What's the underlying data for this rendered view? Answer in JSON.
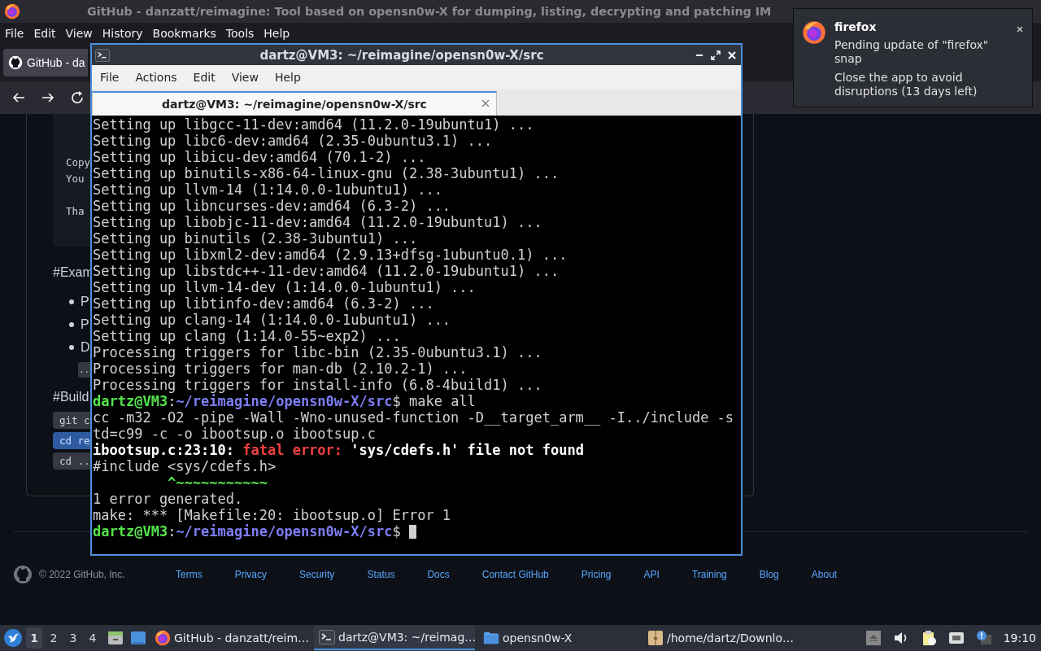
{
  "browser": {
    "title": "GitHub - danzatt/reimagine: Tool based on opensn0w-X for dumping, listing, decrypting and patching IM",
    "menu": [
      "File",
      "Edit",
      "View",
      "History",
      "Bookmarks",
      "Tools",
      "Help"
    ],
    "tabs": [
      {
        "label": "GitHub - da",
        "selected": true
      }
    ],
    "page": {
      "code_lines": [
        "Copy",
        "You",
        "Tha"
      ],
      "examples_heading": "#Exam",
      "bullets": [
        "P",
        "P",
        "D"
      ],
      "inline_code": "..",
      "build_heading": "#Build",
      "build_code": [
        {
          "text": "git c",
          "selected": false
        },
        {
          "text": "cd re",
          "selected": true
        },
        {
          "text": "cd ..",
          "selected": false
        }
      ],
      "footer": {
        "copyright": "© 2022 GitHub, Inc.",
        "links": [
          "Terms",
          "Privacy",
          "Security",
          "Status",
          "Docs",
          "Contact GitHub",
          "Pricing",
          "API",
          "Training",
          "Blog",
          "About"
        ]
      }
    }
  },
  "terminal": {
    "title": "dartz@VM3: ~/reimagine/opensn0w-X/src",
    "menu": [
      "File",
      "Actions",
      "Edit",
      "View",
      "Help"
    ],
    "tabs": [
      {
        "label": "dartz@VM3: ~/reimagine/opensn0w-X/src",
        "selected": true
      }
    ],
    "lines": [
      {
        "segments": [
          {
            "text": "Setting up libgcc-11-dev:amd64 (11.2.0-19ubuntu1) ...",
            "kind": "plain"
          }
        ]
      },
      {
        "segments": [
          {
            "text": "Setting up libc6-dev:amd64 (2.35-0ubuntu3.1) ...",
            "kind": "plain"
          }
        ]
      },
      {
        "segments": [
          {
            "text": "Setting up libicu-dev:amd64 (70.1-2) ...",
            "kind": "plain"
          }
        ]
      },
      {
        "segments": [
          {
            "text": "Setting up binutils-x86-64-linux-gnu (2.38-3ubuntu1) ...",
            "kind": "plain"
          }
        ]
      },
      {
        "segments": [
          {
            "text": "Setting up llvm-14 (1:14.0.0-1ubuntu1) ...",
            "kind": "plain"
          }
        ]
      },
      {
        "segments": [
          {
            "text": "Setting up libncurses-dev:amd64 (6.3-2) ...",
            "kind": "plain"
          }
        ]
      },
      {
        "segments": [
          {
            "text": "Setting up libobjc-11-dev:amd64 (11.2.0-19ubuntu1) ...",
            "kind": "plain"
          }
        ]
      },
      {
        "segments": [
          {
            "text": "Setting up binutils (2.38-3ubuntu1) ...",
            "kind": "plain"
          }
        ]
      },
      {
        "segments": [
          {
            "text": "Setting up libxml2-dev:amd64 (2.9.13+dfsg-1ubuntu0.1) ...",
            "kind": "plain"
          }
        ]
      },
      {
        "segments": [
          {
            "text": "Setting up libstdc++-11-dev:amd64 (11.2.0-19ubuntu1) ...",
            "kind": "plain"
          }
        ]
      },
      {
        "segments": [
          {
            "text": "Setting up llvm-14-dev (1:14.0.0-1ubuntu1) ...",
            "kind": "plain"
          }
        ]
      },
      {
        "segments": [
          {
            "text": "Setting up libtinfo-dev:amd64 (6.3-2) ...",
            "kind": "plain"
          }
        ]
      },
      {
        "segments": [
          {
            "text": "Setting up clang-14 (1:14.0.0-1ubuntu1) ...",
            "kind": "plain"
          }
        ]
      },
      {
        "segments": [
          {
            "text": "Setting up clang (1:14.0-55~exp2) ...",
            "kind": "plain"
          }
        ]
      },
      {
        "segments": [
          {
            "text": "Processing triggers for libc-bin (2.35-0ubuntu3.1) ...",
            "kind": "plain"
          }
        ]
      },
      {
        "segments": [
          {
            "text": "Processing triggers for man-db (2.10.2-1) ...",
            "kind": "plain"
          }
        ]
      },
      {
        "segments": [
          {
            "text": "Processing triggers for install-info (6.8-4build1) ...",
            "kind": "plain"
          }
        ]
      },
      {
        "segments": [
          {
            "text": "dartz@VM3",
            "kind": "user"
          },
          {
            "text": ":",
            "kind": "plain"
          },
          {
            "text": "~/reimagine/opensn0w-X/src",
            "kind": "path"
          },
          {
            "text": "$ make all",
            "kind": "plain"
          }
        ]
      },
      {
        "segments": [
          {
            "text": "cc -m32 -O2 -pipe -Wall -Wno-unused-function -D__target_arm__ -I../include -s",
            "kind": "plain"
          }
        ]
      },
      {
        "segments": [
          {
            "text": "td=c99 -c -o ibootsup.o ibootsup.c",
            "kind": "plain"
          }
        ]
      },
      {
        "segments": [
          {
            "text": "ibootsup.c:23:10: ",
            "kind": "bold"
          },
          {
            "text": "fatal error: ",
            "kind": "error"
          },
          {
            "text": "'sys/cdefs.h' file not found",
            "kind": "bold"
          }
        ]
      },
      {
        "segments": [
          {
            "text": "#include <sys/cdefs.h>",
            "kind": "plain"
          }
        ]
      },
      {
        "segments": [
          {
            "text": "         ^~~~~~~~~~~~",
            "kind": "caret"
          }
        ]
      },
      {
        "segments": [
          {
            "text": "1 error generated.",
            "kind": "plain"
          }
        ]
      },
      {
        "segments": [
          {
            "text": "make: *** [Makefile:20: ibootsup.o] Error 1",
            "kind": "plain"
          }
        ]
      },
      {
        "segments": [
          {
            "text": "dartz@VM3",
            "kind": "user"
          },
          {
            "text": ":",
            "kind": "plain"
          },
          {
            "text": "~/reimagine/opensn0w-X/src",
            "kind": "path"
          },
          {
            "text": "$",
            "kind": "plain"
          }
        ],
        "cursor": true
      }
    ]
  },
  "notification": {
    "app": "firefox",
    "message": "Pending update of \"firefox\" snap",
    "detail": "Close the app to avoid disruptions (13 days left)"
  },
  "taskbar": {
    "workspaces": [
      {
        "label": "1",
        "selected": true
      },
      {
        "label": "2",
        "selected": false
      },
      {
        "label": "3",
        "selected": false
      },
      {
        "label": "4",
        "selected": false
      }
    ],
    "tasks": [
      {
        "label": "GitHub - danzatt/reim…",
        "kind": "browser",
        "selected": false
      },
      {
        "label": "dartz@VM3: ~/reimag…",
        "kind": "terminal",
        "selected": true
      },
      {
        "label": "opensn0w-X",
        "kind": "folder",
        "selected": false
      },
      {
        "label": "/home/dartz/Downlo…",
        "kind": "archive",
        "selected": false
      }
    ],
    "clock": "19:10"
  }
}
